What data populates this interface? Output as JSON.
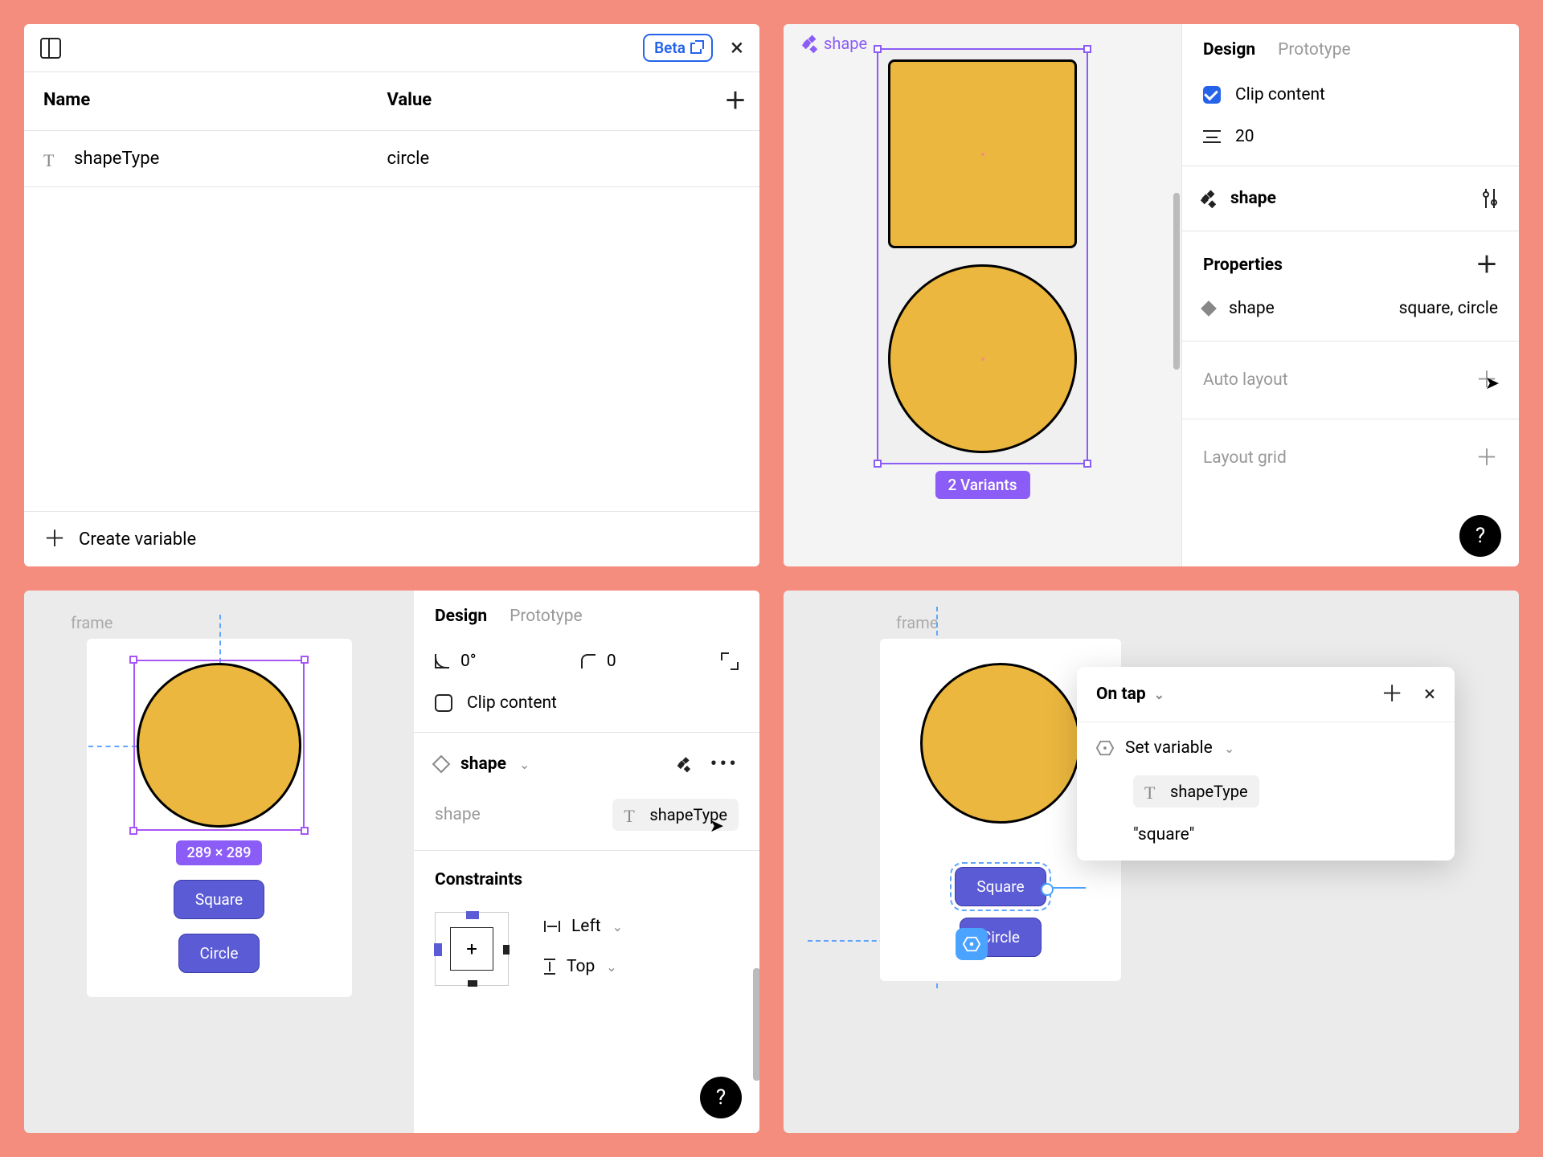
{
  "panel1": {
    "beta": "Beta",
    "headers": {
      "name": "Name",
      "value": "Value"
    },
    "rows": [
      {
        "name": "shapeType",
        "value": "circle"
      }
    ],
    "create": "Create variable"
  },
  "panel2": {
    "component_label": "shape",
    "variant_badge": "2 Variants",
    "tabs": {
      "design": "Design",
      "prototype": "Prototype"
    },
    "clip": "Clip content",
    "gap_value": "20",
    "section_shape": "shape",
    "properties_title": "Properties",
    "prop_name": "shape",
    "prop_values": "square, circle",
    "auto_layout": "Auto layout",
    "layout_grid": "Layout grid"
  },
  "panel3": {
    "frame_label": "frame",
    "dimensions": "289 × 289",
    "btn_square": "Square",
    "btn_circle": "Circle",
    "tabs": {
      "design": "Design",
      "prototype": "Prototype"
    },
    "rotation": "0°",
    "radius": "0",
    "clip": "Clip content",
    "instance_name": "shape",
    "prop_label": "shape",
    "prop_var": "shapeType",
    "constraints_title": "Constraints",
    "con_h": "Left",
    "con_v": "Top"
  },
  "panel4": {
    "frame_label": "frame",
    "btn_square": "Square",
    "btn_circle": "Circle",
    "trigger": "On tap",
    "action": "Set variable",
    "variable": "shapeType",
    "value": "\"square\""
  }
}
